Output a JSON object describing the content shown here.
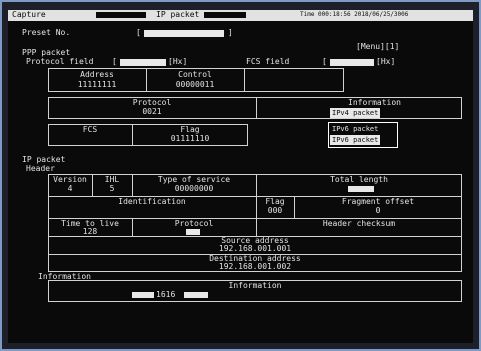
{
  "titlebar": {
    "left": "Capture",
    "mode": "IP packet",
    "right": "Time 000:18:56 2018/06/25/3006"
  },
  "preset": {
    "label": "Preset No.",
    "bracket_open": "[",
    "bracket_close": "]",
    "value": ""
  },
  "menu": {
    "label": "[Menu][1]"
  },
  "ppp": {
    "header": "PPP packet",
    "protocol_field_label": "Protocol field",
    "protocol_field_value": "[Hx]",
    "fcs_field_label": "FCS field",
    "fcs_field_value": "[Hx]",
    "address": {
      "label": "Address",
      "value": "11111111"
    },
    "control": {
      "label": "Control",
      "value": "00000011"
    },
    "protocol": {
      "label": "Protocol",
      "value": "0021"
    },
    "information": {
      "label": "Information"
    },
    "fcs": {
      "label": "FCS",
      "value": ""
    },
    "flag": {
      "label": "Flag",
      "value": "01111110"
    },
    "ipv4_btn1": "IPv4 packet",
    "ipv4_btn2": "IPv4 packet",
    "ipv6_btn1": "IPv6 packet",
    "ipv6_btn2": "IPv6 packet"
  },
  "ip": {
    "header": "IP packet",
    "sub": "Header",
    "version": {
      "label": "Version",
      "value": "4"
    },
    "ihl": {
      "label": "IHL",
      "value": "5"
    },
    "tos": {
      "label": "Type of service",
      "value": "00000000"
    },
    "total_length": {
      "label": "Total length",
      "value": ""
    },
    "identification": {
      "label": "Identification",
      "value": ""
    },
    "flag": {
      "label": "Flag",
      "value": "000"
    },
    "fragment_offset": {
      "label": "Fragment offset",
      "value": "0"
    },
    "ttl": {
      "label": "Time to live",
      "value": "128"
    },
    "protocol": {
      "label": "Protocol",
      "value": ""
    },
    "header_checksum": {
      "label": "Header checksum",
      "value": ""
    },
    "source_address": {
      "label": "Source address",
      "value": "192.168.001.001"
    },
    "destination_address": {
      "label": "Destination address",
      "value": "192.168.001.002"
    },
    "information_section": "Information",
    "information": {
      "label": "Information",
      "value": "1616"
    }
  },
  "colors": {
    "screen": "#0a0a0a",
    "text": "#e4e4e4",
    "bezel": "#1e2029",
    "frame": "#7f9ac4"
  }
}
